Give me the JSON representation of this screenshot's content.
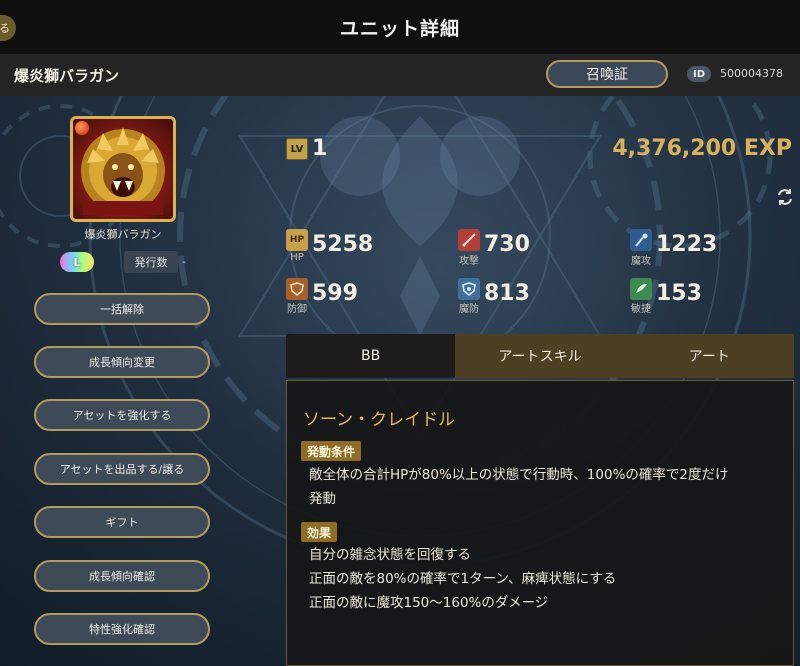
{
  "header": {
    "title": "ユニット詳細",
    "back_label": "る"
  },
  "unit": {
    "name": "爆炎獅バラガン",
    "summon_button": "召喚証",
    "id_label": "ID",
    "id_value": "500004378",
    "portrait_name": "爆炎獅バラガン",
    "rarity_badge": "L",
    "issue_label": "発行数",
    "issue_value": "-"
  },
  "menu": [
    {
      "label": "一括解除"
    },
    {
      "label": "成長傾向変更"
    },
    {
      "label": "アセットを強化する"
    },
    {
      "label": "アセットを出品する/譲る"
    },
    {
      "label": "ギフト"
    },
    {
      "label": "成長傾向確認"
    },
    {
      "label": "特性強化確認"
    }
  ],
  "level": {
    "icon_text": "LV",
    "value": "1",
    "exp": "4,376,200 EXP"
  },
  "stats": [
    {
      "icon": "hp-icon",
      "icon_text": "HP",
      "label": "HP",
      "value": "5258"
    },
    {
      "icon": "attack-icon",
      "icon_text": "",
      "label": "攻撃",
      "value": "730"
    },
    {
      "icon": "magic-attack-icon",
      "icon_text": "",
      "label": "魔攻",
      "value": "1223"
    },
    {
      "icon": "defense-icon",
      "icon_text": "",
      "label": "防御",
      "value": "599"
    },
    {
      "icon": "magic-defense-icon",
      "icon_text": "",
      "label": "魔防",
      "value": "813"
    },
    {
      "icon": "agility-icon",
      "icon_text": "",
      "label": "敏捷",
      "value": "153"
    }
  ],
  "tabs": [
    {
      "label": "BB",
      "active": true
    },
    {
      "label": "アートスキル",
      "active": false
    },
    {
      "label": "アート",
      "active": false
    }
  ],
  "skill": {
    "name": "ソーン・クレイドル",
    "condition_tag": "発動条件",
    "condition_lines": [
      "敵全体の合計HPが80%以上の状態で行動時、100%の確率で2度だけ",
      "発動"
    ],
    "effect_tag": "効果",
    "effect_lines": [
      "自分の雑念状態を回復する",
      "正面の敵を80%の確率で1ターン、麻痺状態にする",
      "正面の敵に魔攻150～160%のダメージ"
    ]
  },
  "colors": {
    "accent_gold": "#d8b15a",
    "tab_brown": "#4d3f22",
    "button_border": "#b49a5b"
  }
}
